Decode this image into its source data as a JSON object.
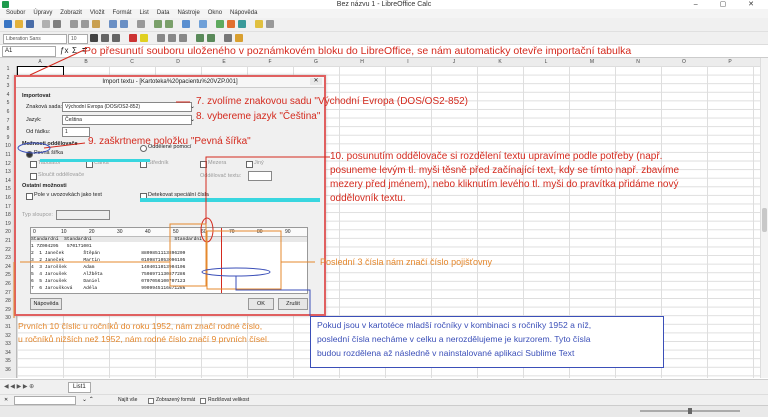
{
  "window": {
    "title": "Bez názvu 1 - LibreOffice Calc",
    "controls": "– ▢ ✕"
  },
  "menu": [
    "Soubor",
    "Úpravy",
    "Zobrazit",
    "Vložit",
    "Formát",
    "List",
    "Data",
    "Nástroje",
    "Okno",
    "Nápověda"
  ],
  "formatting": {
    "font_name": "Liberation Sans",
    "font_size": "10"
  },
  "formula_bar": {
    "name_box": "A1",
    "sigma": "Σ",
    "equals": "="
  },
  "sheet": {
    "columns": [
      "A",
      "B",
      "C",
      "D",
      "E",
      "F",
      "G",
      "H",
      "I",
      "J",
      "K",
      "L",
      "M",
      "N",
      "O",
      "P"
    ],
    "rows": [
      "1",
      "2",
      "3",
      "4",
      "5",
      "6",
      "7",
      "8",
      "9",
      "10",
      "11",
      "12",
      "13",
      "14",
      "15",
      "16",
      "17",
      "18",
      "19",
      "20",
      "21",
      "22",
      "23",
      "24",
      "25",
      "26",
      "27",
      "28",
      "29",
      "30",
      "31",
      "32",
      "33",
      "34",
      "35",
      "36"
    ],
    "tab": "List1"
  },
  "find_bar": {
    "label": "Najít vše",
    "option1": "Zobrazený formát",
    "option2": "Rozlišovat velikost"
  },
  "dialog": {
    "title": "Import textu - [Kartoteka%20pacientu%20VZP.001]",
    "import_heading": "Importovat",
    "charset_label": "Znaková sada:",
    "charset_value": "Východní Evropa (DOS/OS2-852)",
    "language_label": "Jazyk:",
    "language_value": "Čeština",
    "from_row_label": "Od řádku:",
    "from_row_value": "1",
    "sep_heading": "Možnosti oddělovače",
    "fixed_width": "Pevná šířka",
    "separated": "Oddělené pomocí",
    "tab_label": "Tabulátor",
    "comma_label": "Čárka",
    "semicolon_label": "Středník",
    "space_label": "Mezera",
    "other_label": "Jiný",
    "merge_label": "Sloučit oddělovače",
    "string_delim_label": "Oddělovač textu:",
    "other_options": "Ostatní možnosti",
    "quoted_as_text": "Pole v uvozovkách jako text",
    "detect_numbers": "Detekovat speciální čísla",
    "field_type_label": "Typ sloupce:",
    "ruler_marks": [
      "0",
      "10",
      "20",
      "30",
      "40",
      "50",
      "60",
      "70",
      "80",
      "90"
    ],
    "preview_header": "Standardní  Standardní                              Standardní",
    "preview_rows": [
      "1 7Z004295   570171001",
      "2  1 Janeček       Štěpán               8809851113896209",
      "3  2 Janeček       Martin               0109871053096105",
      "4  3 Jaroššek      Adam                 1404011013904106",
      "5  4 Jaroušek      Alžběta              7508971130877286",
      "6  5 Jaroušek      Daniel               0707056100707123",
      "7  6 Jaroušková    Adéla                9909945116671286"
    ],
    "help": "Nápověda",
    "ok": "OK",
    "cancel": "Zrušit"
  },
  "annotations": {
    "top": "Po přesunutí souboru uloženého v poznámkovém bloku do LibreOffice, se nám automaticky otevře importační tabulka",
    "step7": "7. zvolíme znakovou sadu \"Východní Evropa (DOS/OS2-852)",
    "step8": "8. vybereme jazyk \"Čeština\"",
    "step9": "9. zaškrtneme položku \"Pevná šířka\"",
    "step10_line1": "10. posunutím oddělovače si rozdělení textu upravíme podle potřeby (např.",
    "step10_line2": "posuneme levým tl. myši těsně před začínající text, kdy se tímto např. zbavíme",
    "step10_line3": "mezery před jménem), nebo kliknutím levého tl. myši do pravítka přidáme nový",
    "step10_line4": "oddělovník textu.",
    "last3": "Poslední 3 čísla nám značí číslo pojišťovny",
    "orange_line1": "Prvních 10 číslic u ročníků do roku 1952, nám značí rodné číslo,",
    "orange_line2": "u ročníků nižších než 1952, nám rodné číslo značí 9 prvních čísel.",
    "blue_line1": "Pokud jsou v kartotéce mladší ročníky v kombinaci s ročníky 1952 a níž,",
    "blue_line2": "poslední čísla necháme v celku a nerozdělujeme je kurzorem. Tyto čísla",
    "blue_line3": "budou rozdělena až následně v nainstalované aplikaci Sublime Text"
  },
  "colors": {
    "annotation_red": "#d42a1e",
    "annotation_orange": "#e5882d",
    "annotation_blue": "#3b4fb8",
    "dialog_border": "#e06060"
  }
}
